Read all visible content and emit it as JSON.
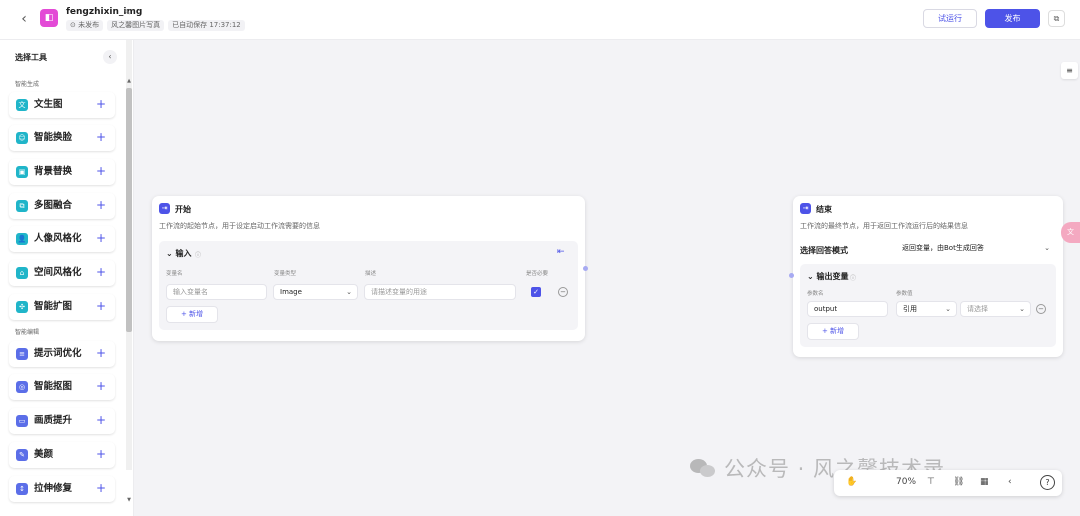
{
  "header": {
    "back_icon": "chevron-left-icon",
    "app_icon": "workflow-icon",
    "app_name": "fengzhixin_img",
    "status": "⊙ 未发布",
    "space": "风之馨图片写真",
    "autosave": "已自动保存 17:37:12",
    "test_run_label": "试运行",
    "publish_label": "发布",
    "accent": "#4d53e8"
  },
  "sidebar": {
    "title": "选择工具",
    "section_generate": "智能生成",
    "section_edit": "智能编辑",
    "items": [
      {
        "label": "文生图",
        "icon": "text-to-image-icon",
        "glyph": "文",
        "color": "#20b5c9"
      },
      {
        "label": "智能换脸",
        "icon": "face-swap-icon",
        "glyph": "☺",
        "color": "#20b5c9"
      },
      {
        "label": "背景替换",
        "icon": "background-replace-icon",
        "glyph": "▣",
        "color": "#20b5c9"
      },
      {
        "label": "多图融合",
        "icon": "image-fusion-icon",
        "glyph": "⧉",
        "color": "#20b5c9"
      },
      {
        "label": "人像风格化",
        "icon": "portrait-style-icon",
        "glyph": "👤",
        "color": "#20b5c9"
      },
      {
        "label": "空间风格化",
        "icon": "space-style-icon",
        "glyph": "⌂",
        "color": "#20b5c9"
      },
      {
        "label": "智能扩图",
        "icon": "image-expand-icon",
        "glyph": "✣",
        "color": "#20b5c9"
      },
      {
        "label": "提示词优化",
        "icon": "prompt-optimize-icon",
        "glyph": "≡",
        "color": "#5b6ee8"
      },
      {
        "label": "智能抠图",
        "icon": "cutout-icon",
        "glyph": "◎",
        "color": "#5b6ee8"
      },
      {
        "label": "画质提升",
        "icon": "quality-up-icon",
        "glyph": "▭",
        "color": "#5b6ee8"
      },
      {
        "label": "美颜",
        "icon": "beauty-icon",
        "glyph": "✎",
        "color": "#5b6ee8"
      },
      {
        "label": "拉伸修复",
        "icon": "stretch-fix-icon",
        "glyph": "↕",
        "color": "#5b6ee8"
      }
    ]
  },
  "start_node": {
    "title": "开始",
    "desc": "工作流的起始节点，用于设定启动工作流需要的信息",
    "section": "输入",
    "col_name": "变量名",
    "col_type": "变量类型",
    "col_desc": "描述",
    "col_required": "是否必要",
    "name_placeholder": "输入变量名",
    "type_value": "Image",
    "desc_placeholder": "请描述变量的用途",
    "add_label": "+ 新增"
  },
  "end_node": {
    "title": "结束",
    "desc": "工作流的最终节点，用于返回工作流运行后的结果信息",
    "mode_label": "选择回答模式",
    "mode_value": "返回变量，由Bot生成回答",
    "section": "输出变量",
    "col_param": "参数名",
    "col_value": "参数值",
    "param_value": "output",
    "ref_value": "引用",
    "select_placeholder": "请选择",
    "add_label": "+ 新增"
  },
  "toolbar": {
    "zoom": "70%",
    "icons": [
      "hand-icon",
      "zoom-level",
      "layout-icon",
      "link-icon",
      "grid-icon",
      "undo-icon",
      "help-icon"
    ]
  },
  "watermark": "公众号 · 风之馨技术录"
}
